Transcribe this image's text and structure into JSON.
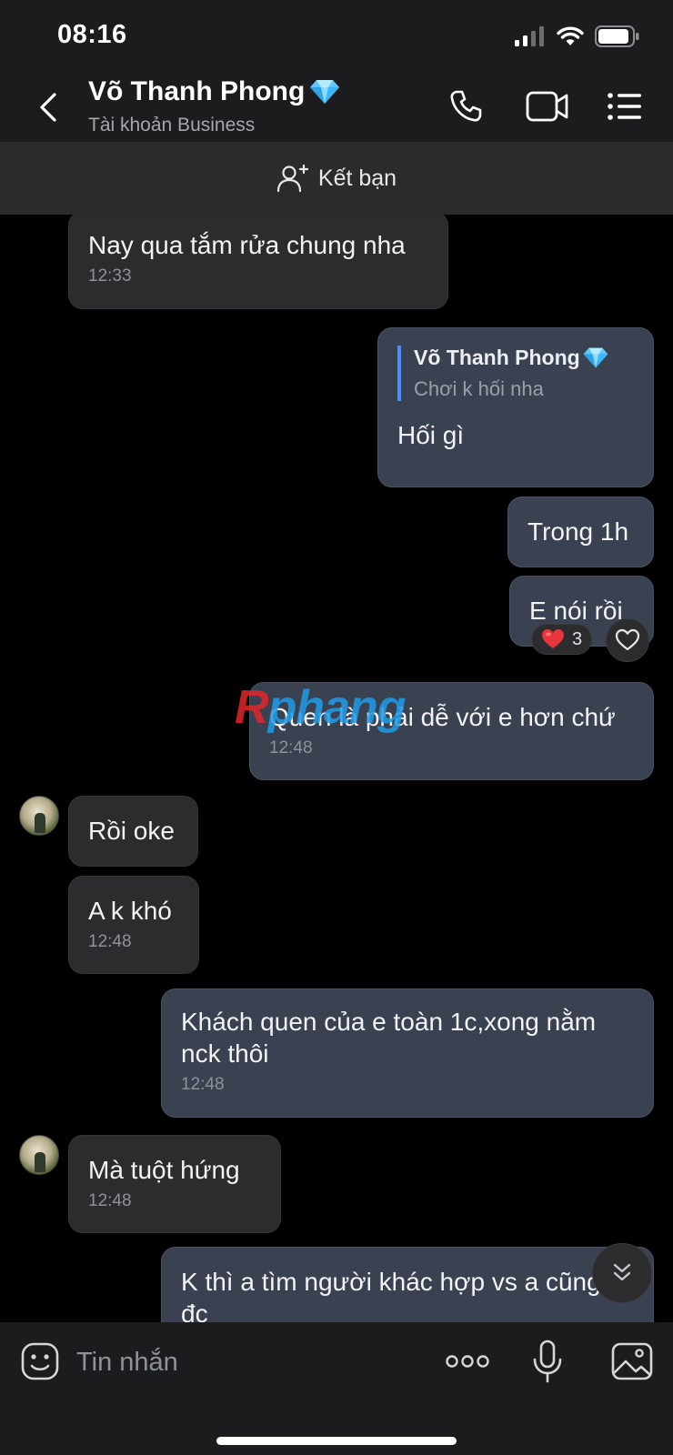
{
  "status_bar": {
    "time": "08:16",
    "battery_level": 0.9
  },
  "header": {
    "name": "Võ Thanh Phong",
    "subtitle": "Tài khoản Business",
    "badge_icon": "diamond-icon",
    "actions": [
      "phone-icon",
      "video-call-icon",
      "menu-list-icon"
    ]
  },
  "friend_bar": {
    "label": "Kết bạn",
    "icon": "add-friend-icon"
  },
  "messages": [
    {
      "side": "in",
      "text": "Nay qua tắm rửa chung nha",
      "time": "12:33"
    },
    {
      "side": "out",
      "reply": {
        "name": "Võ Thanh Phong",
        "text": "Chơi k hối nha"
      },
      "text": "Hối gì"
    },
    {
      "side": "out",
      "text": "Trong 1h"
    },
    {
      "side": "out",
      "text": "E nói rồi",
      "reaction": {
        "emoji": "❤️",
        "count": "3"
      }
    },
    {
      "side": "out",
      "text": "Quen là phải dễ với e hơn chứ",
      "time": "12:48"
    },
    {
      "side": "in",
      "text": "Rồi oke"
    },
    {
      "side": "in",
      "text": "A k khó",
      "time": "12:48"
    },
    {
      "side": "out",
      "text": "Khách quen của e toàn 1c,xong nằm nck thôi",
      "time": "12:48"
    },
    {
      "side": "in",
      "text": "Mà tuột hứng",
      "time": "12:48"
    },
    {
      "side": "out",
      "text": "K thì a tìm người khác hợp vs a cũng đc"
    }
  ],
  "watermark": {
    "part1": "R",
    "part2": "phang"
  },
  "composer": {
    "placeholder": "Tin nhắn"
  },
  "colors": {
    "background": "#000000",
    "header": "#1c1c1e",
    "incoming_bubble": "#2c2c2e",
    "outgoing_bubble": "#3a4150",
    "reply_bar": "#4f8dff",
    "timestamp": "#8e929a"
  }
}
